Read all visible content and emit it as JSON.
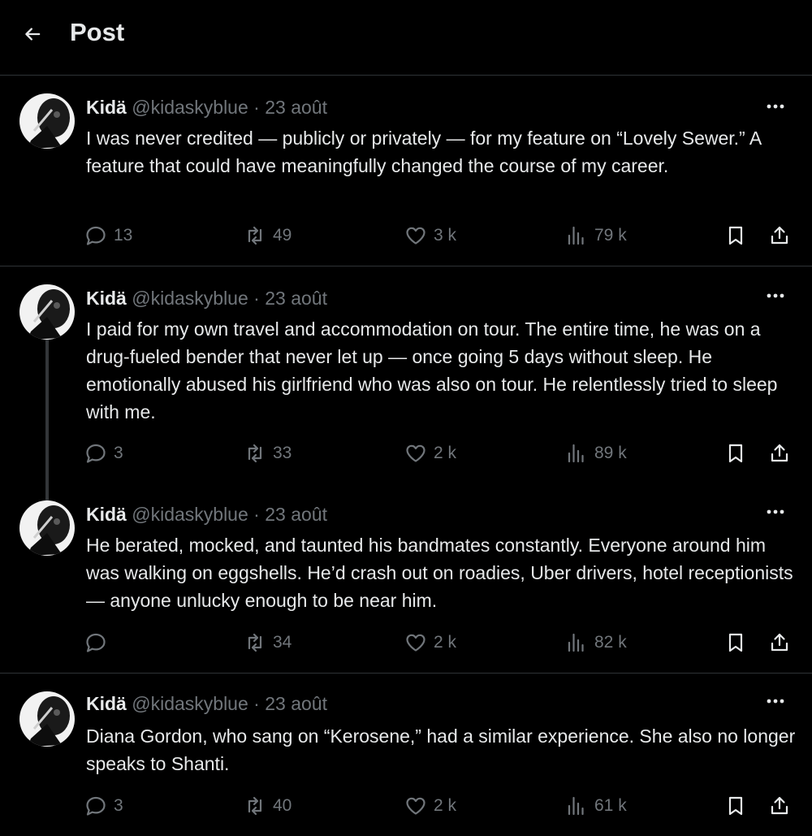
{
  "header": {
    "title": "Post",
    "back_icon": "arrow-left-icon"
  },
  "colors": {
    "background": "#000000",
    "text": "#e7e9ea",
    "muted": "#71767b",
    "border": "#2f3336"
  },
  "tweets": [
    {
      "name": "Kidä",
      "handle": "@kidaskyblue",
      "separator": "·",
      "date": "23 août",
      "text": "I was never credited — publicly or privately — for my feature on “Lovely Sewer.” A feature that could have meaningfully changed the course of my career.",
      "replies": "13",
      "reposts": "49",
      "likes": "3 k",
      "views": "79 k"
    },
    {
      "name": "Kidä",
      "handle": "@kidaskyblue",
      "separator": "·",
      "date": "23 août",
      "text": "I paid for my own travel and accommodation on tour. The entire time, he was on a drug-fueled bender that never let up — once going 5 days without sleep. He emotionally abused his girlfriend who was also on tour. He relentlessly tried to sleep with me.",
      "replies": "3",
      "reposts": "33",
      "likes": "2 k",
      "views": "89 k"
    },
    {
      "name": "Kidä",
      "handle": "@kidaskyblue",
      "separator": "·",
      "date": "23 août",
      "text": "He berated, mocked, and taunted his bandmates constantly. Everyone around him was walking on eggshells. He’d crash out on roadies, Uber drivers, hotel receptionists — anyone unlucky enough to be near him.",
      "replies": "",
      "reposts": "34",
      "likes": "2 k",
      "views": "82 k"
    },
    {
      "name": "Kidä",
      "handle": "@kidaskyblue",
      "separator": "·",
      "date": "23 août",
      "text": "Diana Gordon, who sang on “Kerosene,” had a similar experience. She also no longer speaks to Shanti.",
      "replies": "3",
      "reposts": "40",
      "likes": "2 k",
      "views": "61 k"
    }
  ]
}
